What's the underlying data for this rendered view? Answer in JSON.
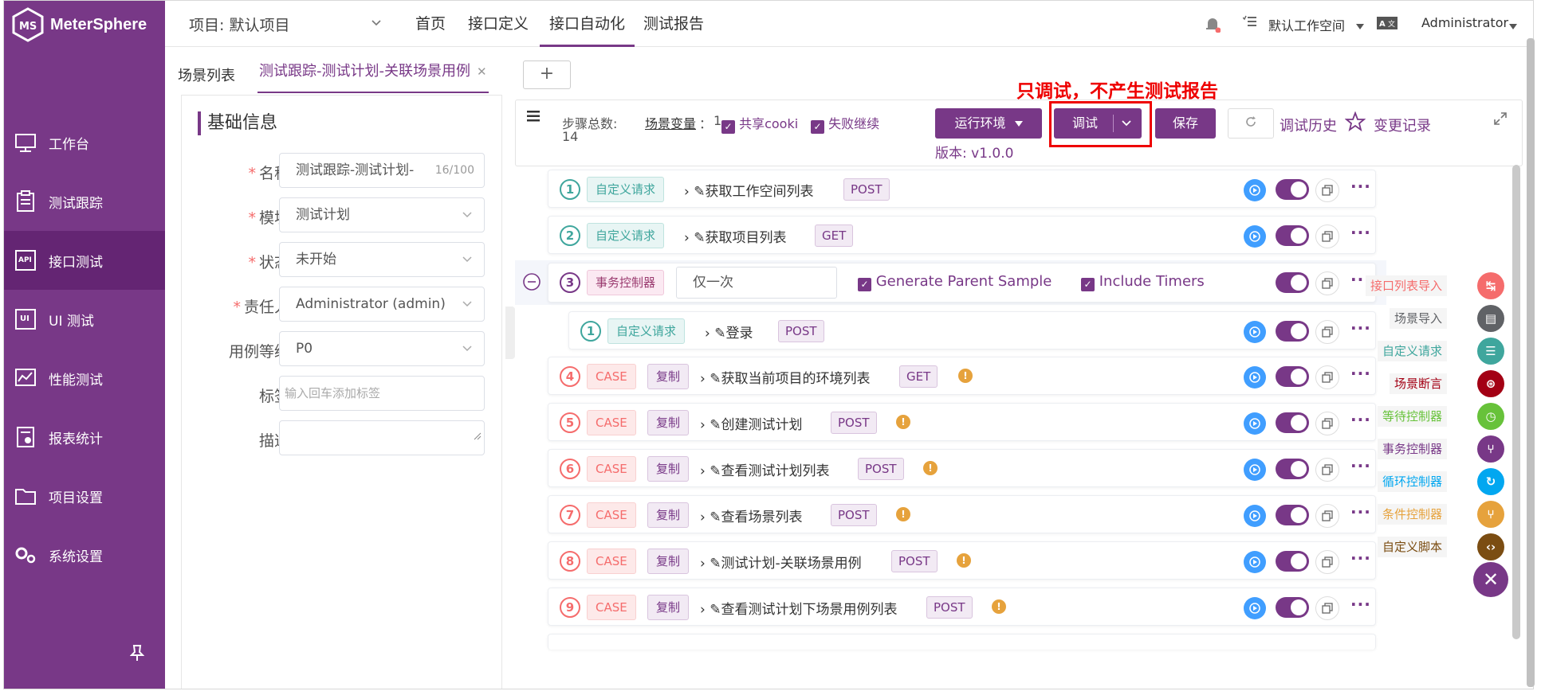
{
  "app": {
    "name": "MeterSphere"
  },
  "sidebar": {
    "items": [
      {
        "label": "工作台",
        "icon": "monitor-icon"
      },
      {
        "label": "测试跟踪",
        "icon": "clipboard-icon"
      },
      {
        "label": "接口测试",
        "icon": "api-icon",
        "active": true
      },
      {
        "label": "UI 测试",
        "icon": "ui-icon"
      },
      {
        "label": "性能测试",
        "icon": "chart-icon"
      },
      {
        "label": "报表统计",
        "icon": "report-icon"
      },
      {
        "label": "项目设置",
        "icon": "folder-icon"
      },
      {
        "label": "系统设置",
        "icon": "gears-icon"
      }
    ]
  },
  "header": {
    "project": "项目: 默认项目",
    "menus": [
      "首页",
      "接口定义",
      "接口自动化",
      "测试报告"
    ],
    "active_menu": "接口自动化",
    "workspace": "默认工作空间",
    "user": "Administrator"
  },
  "tabs": {
    "list_tab": "场景列表",
    "open_tab": "测试跟踪-测试计划-关联场景用例",
    "add": "+"
  },
  "form": {
    "title": "基础信息",
    "name_label": "名称",
    "name_value": "测试跟踪-测试计划-",
    "name_count": "16/100",
    "module_label": "模块",
    "module_value": "测试计划",
    "status_label": "状态",
    "status_value": "未开始",
    "owner_label": "责任人",
    "owner_value": "Administrator (admin)",
    "level_label": "用例等级",
    "level_value": "P0",
    "tag_label": "标签",
    "tag_placeholder": "输入回车添加标签",
    "desc_label": "描述"
  },
  "toolbar": {
    "steps_label": "步骤总数:",
    "steps_count": "14",
    "vars_label": "场景变量",
    "vars_count": "1",
    "share_cookie": "共享cooki",
    "fail_continue": "失败继续",
    "env_button": "运行环境",
    "debug_button": "调试",
    "save_button": "保存",
    "history": "调试历史",
    "changes": "变更记录",
    "version": "版本: v1.0.0",
    "annotation": "只调试，不产生测试报告"
  },
  "steps": [
    {
      "num": "1",
      "type": "自定义请求",
      "name": "获取工作空间列表",
      "method": "POST"
    },
    {
      "num": "2",
      "type": "自定义请求",
      "name": "获取项目列表",
      "method": "GET"
    },
    {
      "num": "3",
      "type": "事务控制器",
      "input": "仅一次",
      "opt1": "Generate Parent Sample",
      "opt2": "Include Timers"
    },
    {
      "num": "1",
      "type": "自定义请求",
      "name": "登录",
      "method": "POST"
    },
    {
      "num": "4",
      "case": "CASE",
      "copy": "复制",
      "name": "获取当前项目的环境列表",
      "method": "GET"
    },
    {
      "num": "5",
      "case": "CASE",
      "copy": "复制",
      "name": "创建测试计划",
      "method": "POST"
    },
    {
      "num": "6",
      "case": "CASE",
      "copy": "复制",
      "name": "查看测试计划列表",
      "method": "POST"
    },
    {
      "num": "7",
      "case": "CASE",
      "copy": "复制",
      "name": "查看场景列表",
      "method": "POST"
    },
    {
      "num": "8",
      "case": "CASE",
      "copy": "复制",
      "name": "测试计划-关联场景用例",
      "method": "POST"
    },
    {
      "num": "9",
      "case": "CASE",
      "copy": "复制",
      "name": "查看测试计划下场景用例列表",
      "method": "POST"
    }
  ],
  "tools": [
    {
      "label": "接口列表导入",
      "color": "#f56c6c",
      "text_color": "#f56c6c"
    },
    {
      "label": "场景导入",
      "color": "#606266",
      "text_color": "#606266"
    },
    {
      "label": "自定义请求",
      "color": "#3fa69d",
      "text_color": "#3fa69d"
    },
    {
      "label": "场景断言",
      "color": "#a30014",
      "text_color": "#a30014"
    },
    {
      "label": "等待控制器",
      "color": "#67c23a",
      "text_color": "#67c23a"
    },
    {
      "label": "事务控制器",
      "color": "#783887",
      "text_color": "#783887"
    },
    {
      "label": "循环控制器",
      "color": "#02a7f0",
      "text_color": "#02a7f0"
    },
    {
      "label": "条件控制器",
      "color": "#e6a23c",
      "text_color": "#e6a23c"
    },
    {
      "label": "自定义脚本",
      "color": "#7b4d12",
      "text_color": "#7b4d12"
    }
  ]
}
